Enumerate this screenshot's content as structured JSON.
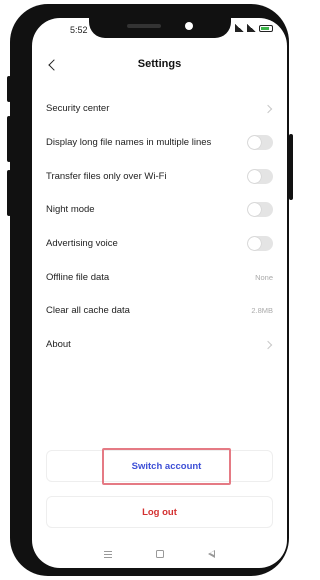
{
  "status_bar": {
    "time": "5:52"
  },
  "header": {
    "title": "Settings"
  },
  "settings": [
    {
      "label": "Security center",
      "control": "chevron"
    },
    {
      "label": "Display long file names in multiple lines",
      "control": "toggle",
      "on": false
    },
    {
      "label": "Transfer files only over Wi-Fi",
      "control": "toggle",
      "on": false
    },
    {
      "label": "Night mode",
      "control": "toggle",
      "on": false
    },
    {
      "label": "Advertising voice",
      "control": "toggle",
      "on": false
    },
    {
      "label": "Offline file data",
      "control": "value",
      "value": "None"
    },
    {
      "label": "Clear all cache data",
      "control": "value",
      "value": "2.8MB"
    },
    {
      "label": "About",
      "control": "chevron"
    }
  ],
  "actions": {
    "switch_account": "Switch account",
    "log_out": "Log out"
  },
  "colors": {
    "switch_account_text": "#3d4fd6",
    "log_out_text": "#d33030",
    "highlight_border": "#e57a84"
  }
}
